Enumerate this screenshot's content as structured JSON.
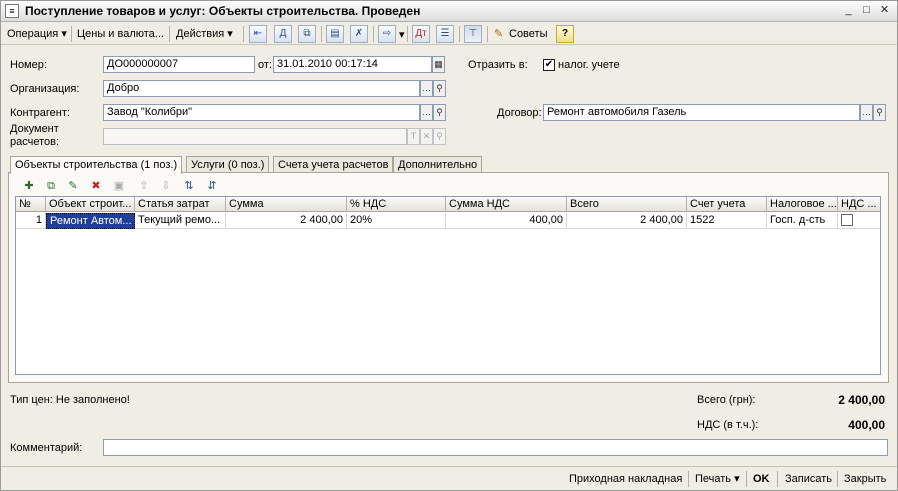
{
  "window": {
    "title": "Поступление товаров и услуг: Объекты строительства. Проведен",
    "minimize": "_",
    "maximize": "□",
    "close": "✕"
  },
  "toolbar": {
    "operation": "Операция ▾",
    "prices": "Цены и валюта...",
    "actions": "Действия ▾",
    "tips": "Советы",
    "help": "?"
  },
  "form": {
    "number_label": "Номер:",
    "number_value": "ДО000000007",
    "date_label": "от:",
    "date_value": "31.01.2010 00:17:14",
    "reflect_label": "Отразить в:",
    "tax_label": "налог. учете",
    "tax_checked": "✔",
    "org_label": "Организация:",
    "org_value": "Добро",
    "contractor_label": "Контрагент:",
    "contractor_value": "Завод \"Колибри\"",
    "contract_label": "Договор:",
    "contract_value": "Ремонт автомобиля Газель",
    "settlement_doc_label_1": "Документ",
    "settlement_doc_label_2": "расчетов:",
    "settlement_doc_value": ""
  },
  "tabs": [
    {
      "label": "Объекты строительства (1 поз.)"
    },
    {
      "label": "Услуги (0 поз.)"
    },
    {
      "label": "Счета учета расчетов"
    },
    {
      "label": "Дополнительно"
    }
  ],
  "table": {
    "columns": [
      "№",
      "Объект строит...",
      "Статья затрат",
      "Сумма",
      "% НДС",
      "Сумма НДС",
      "Всего",
      "Счет учета",
      "Налоговое ...",
      "НДС ..."
    ],
    "rows": [
      {
        "num": "1",
        "object": "Ремонт Автом...",
        "cost_item": "Текущий ремо...",
        "sum": "2 400,00",
        "vat_rate": "20%",
        "vat_sum": "400,00",
        "total": "2 400,00",
        "account": "1522",
        "tax": "Госп. д-сть",
        "vat_flag": ""
      }
    ]
  },
  "summary": {
    "price_type": "Тип цен: Не заполнено!",
    "total_label": "Всего (грн):",
    "total_value": "2 400,00",
    "vat_label": "НДС (в т.ч.):",
    "vat_value": "400,00"
  },
  "comment": {
    "label": "Комментарий:",
    "value": ""
  },
  "bottom": {
    "invoice": "Приходная накладная",
    "print": "Печать ▾",
    "ok": "OK",
    "save": "Записать",
    "close": "Закрыть"
  }
}
